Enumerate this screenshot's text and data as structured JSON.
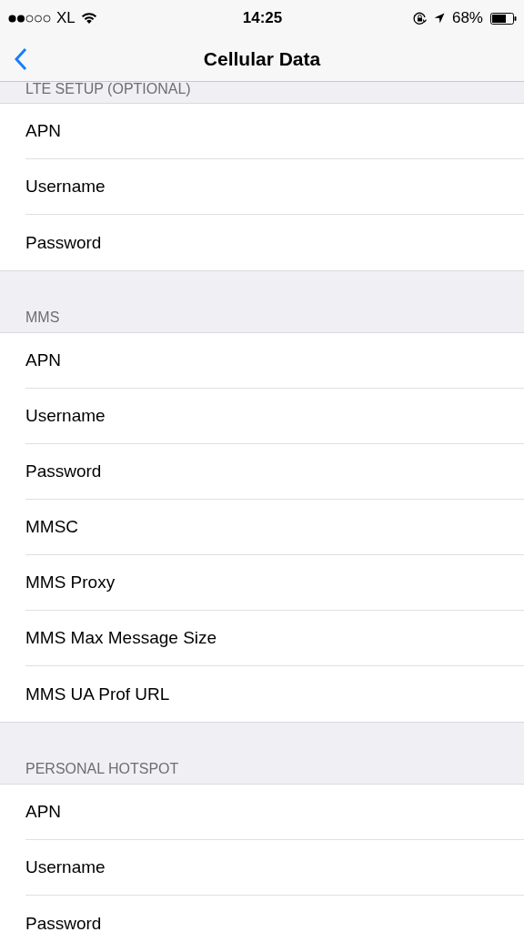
{
  "status_bar": {
    "carrier": "XL",
    "time": "14:25",
    "battery": "68%"
  },
  "nav_bar": {
    "title": "Cellular Data"
  },
  "sections": [
    {
      "header": "LTE SETUP (OPTIONAL)",
      "rows": [
        "APN",
        "Username",
        "Password"
      ]
    },
    {
      "header": "MMS",
      "rows": [
        "APN",
        "Username",
        "Password",
        "MMSC",
        "MMS Proxy",
        "MMS Max Message Size",
        "MMS UA Prof URL"
      ]
    },
    {
      "header": "PERSONAL HOTSPOT",
      "rows": [
        "APN",
        "Username",
        "Password"
      ]
    }
  ]
}
